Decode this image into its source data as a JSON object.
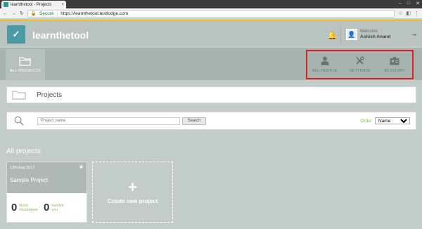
{
  "browser": {
    "tab_title": "learnthetool - Projects",
    "tab_close": "×",
    "secure_label": "Secure",
    "url": "https://learnthetool.testlodge.com"
  },
  "header": {
    "brand": "learnthetool",
    "welcome": "Welcome",
    "user_name": "Ashish Anand"
  },
  "nav": {
    "all_projects": "ALL PROJECTS",
    "items": [
      {
        "label": "ALL PEOPLE",
        "icon": "person-icon"
      },
      {
        "label": "SETTINGS",
        "icon": "tools-icon"
      },
      {
        "label": "ACCOUNT",
        "icon": "id-card-icon"
      }
    ]
  },
  "projects_section": {
    "title": "Projects"
  },
  "search": {
    "placeholder": "Project name",
    "button": "Search",
    "order_label": "Order",
    "order_value": "Name"
  },
  "all_projects_title": "All projects",
  "project_cards": [
    {
      "date": "12th Aug 2017",
      "name": "Sample Project",
      "runs_count": "0",
      "runs_label_1": "Runs",
      "runs_label_2": "incomplete",
      "involve_count": "0",
      "involve_label_1": "Involve",
      "involve_label_2": "you"
    }
  ],
  "create_project": {
    "label": "Create new project"
  },
  "colors": {
    "accent_yellow": "#f0c419",
    "highlight_red": "#e02020",
    "stat_green": "#8ab84a",
    "logo_teal": "#4c9aa6"
  }
}
